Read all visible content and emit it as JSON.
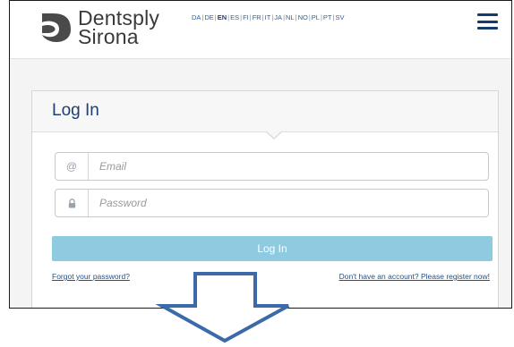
{
  "header": {
    "brand_line1": "Dentsply",
    "brand_line2": "Sirona",
    "languages": [
      "DA",
      "DE",
      "EN",
      "ES",
      "FI",
      "FR",
      "IT",
      "JA",
      "NL",
      "NO",
      "PL",
      "PT",
      "SV"
    ],
    "active_language": "EN",
    "menu_icon": "hamburger-menu-icon"
  },
  "login": {
    "title": "Log In",
    "email_placeholder": "Email",
    "email_icon": "@",
    "password_placeholder": "Password",
    "password_icon": "lock-icon",
    "submit_label": "Log In",
    "forgot_link": "Forgot your password?",
    "register_link": "Don't have an account? Please register now!"
  },
  "colors": {
    "brand_navy": "#153c71",
    "button": "#8ecae0",
    "arrow_stroke": "#3a6aa8",
    "arrow_fill": "#ffffff"
  }
}
